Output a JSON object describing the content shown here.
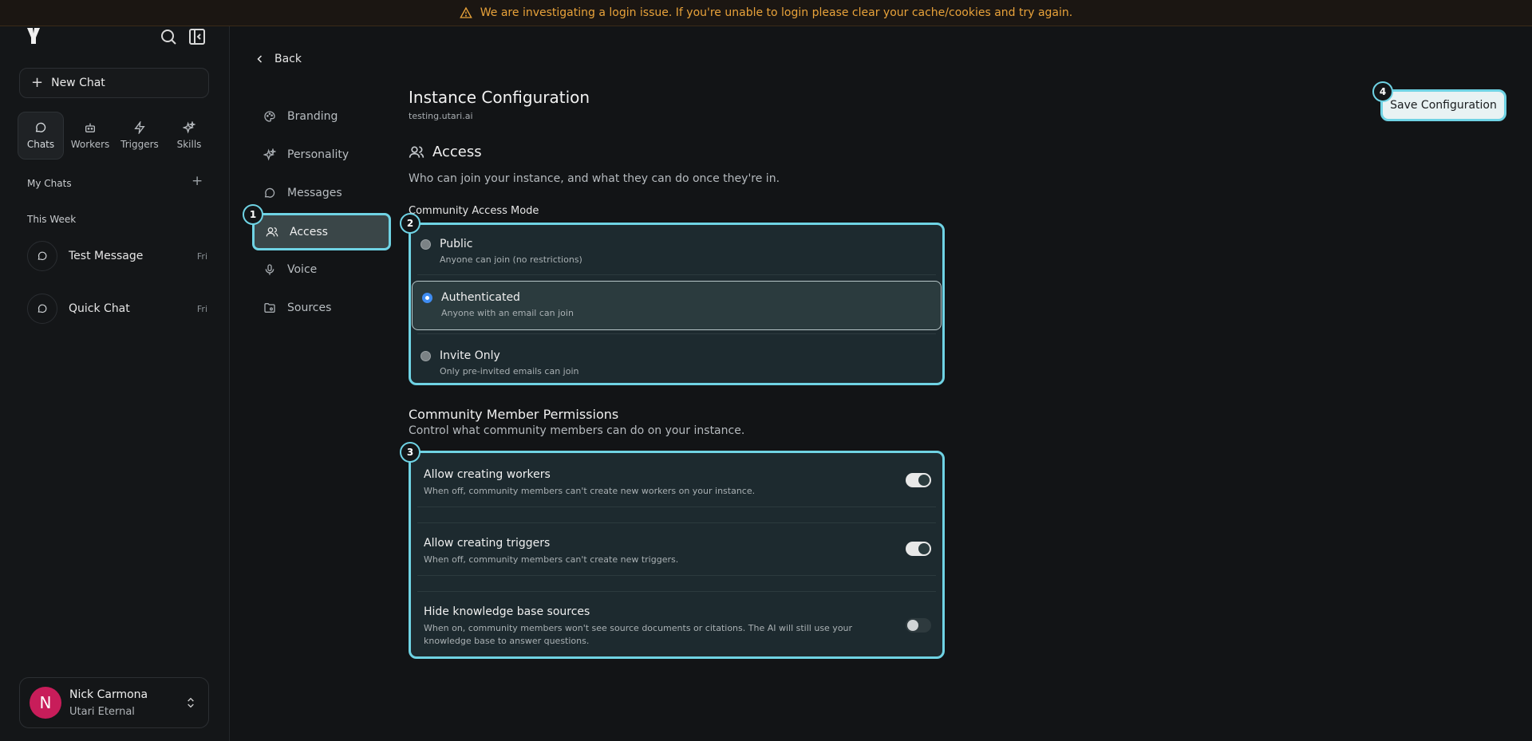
{
  "banner": {
    "text": "We are investigating a login issue. If you're unable to login please clear your cache/cookies and try again."
  },
  "sidebar": {
    "new_chat": "New Chat",
    "nav": [
      {
        "label": "Chats",
        "icon": "chat-bubble-icon",
        "active": true
      },
      {
        "label": "Workers",
        "icon": "robot-icon"
      },
      {
        "label": "Triggers",
        "icon": "lightning-icon"
      },
      {
        "label": "Skills",
        "icon": "sparkles-icon"
      }
    ],
    "my_chats": "My Chats",
    "this_week": "This Week",
    "chats": [
      {
        "title": "Test Message",
        "day": "Fri"
      },
      {
        "title": "Quick Chat",
        "day": "Fri"
      }
    ],
    "user": {
      "initial": "N",
      "name": "Nick Carmona",
      "org": "Utari Eternal"
    }
  },
  "settings_nav": {
    "back": "Back",
    "items": [
      {
        "label": "Branding",
        "icon": "palette-icon"
      },
      {
        "label": "Personality",
        "icon": "sparkle-icon"
      },
      {
        "label": "Messages",
        "icon": "message-icon"
      },
      {
        "label": "Access",
        "icon": "users-icon",
        "active": true
      },
      {
        "label": "Voice",
        "icon": "microphone-icon"
      },
      {
        "label": "Sources",
        "icon": "folder-icon"
      }
    ]
  },
  "main": {
    "title": "Instance Configuration",
    "subdomain": "testing.utari.ai",
    "section_title": "Access",
    "section_desc": "Who can join your instance, and what they can do once they're in.",
    "mode_label": "Community Access Mode",
    "modes": [
      {
        "title": "Public",
        "sub": "Anyone can join (no restrictions)",
        "selected": false
      },
      {
        "title": "Authenticated",
        "sub": "Anyone with an email can join",
        "selected": true
      },
      {
        "title": "Invite Only",
        "sub": "Only pre-invited emails can join",
        "selected": false
      }
    ],
    "perm_title": "Community Member Permissions",
    "perm_desc": "Control what community members can do on your instance.",
    "permissions": [
      {
        "title": "Allow creating workers",
        "sub": "When off, community members can't create new workers on your instance.",
        "on": true
      },
      {
        "title": "Allow creating triggers",
        "sub": "When off, community members can't create new triggers.",
        "on": true
      },
      {
        "title": "Hide knowledge base sources",
        "sub": "When on, community members won't see source documents or citations. The AI will still use your knowledge base to answer questions.",
        "on": false
      }
    ],
    "save_label": "Save Configuration"
  },
  "badges": [
    "1",
    "2",
    "3",
    "4"
  ],
  "colors": {
    "highlight": "#6fd3e4",
    "banner_text": "#e8a23a",
    "avatar": "#c81d5a",
    "radio_selected": "#3f8cf2"
  }
}
